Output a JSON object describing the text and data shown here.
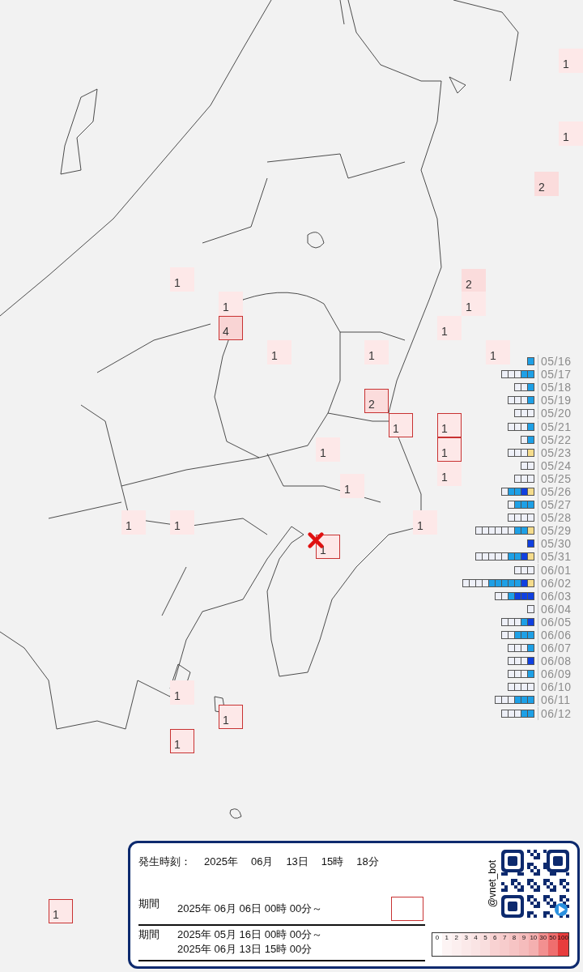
{
  "map": {
    "markers": [
      {
        "label": "1",
        "bordered": false,
        "color": "#fde8e8"
      },
      {
        "label": "1",
        "bordered": false,
        "color": "#fde8e8"
      },
      {
        "label": "2",
        "bordered": false,
        "color": "#fbdcdc"
      },
      {
        "label": "1",
        "bordered": false,
        "color": "#fde8e8"
      },
      {
        "label": "2",
        "bordered": false,
        "color": "#fbdcdc"
      },
      {
        "label": "1",
        "bordered": false,
        "color": "#fde8e8"
      },
      {
        "label": "1",
        "bordered": false,
        "color": "#fde8e8"
      },
      {
        "label": "4",
        "bordered": true,
        "color": "#f9d4d4"
      },
      {
        "label": "1",
        "bordered": false,
        "color": "#fde8e8"
      },
      {
        "label": "1",
        "bordered": false,
        "color": "#fde8e8"
      },
      {
        "label": "1",
        "bordered": false,
        "color": "#fde8e8"
      },
      {
        "label": "1",
        "bordered": false,
        "color": "#fde8e8"
      },
      {
        "label": "2",
        "bordered": true,
        "color": "#fbdcdc"
      },
      {
        "label": "1",
        "bordered": true,
        "color": "#fde8e8"
      },
      {
        "label": "1",
        "bordered": true,
        "color": "#fde8e8"
      },
      {
        "label": "1",
        "bordered": false,
        "color": "#fde8e8"
      },
      {
        "label": "1",
        "bordered": true,
        "color": "#fde8e8"
      },
      {
        "label": "1",
        "bordered": false,
        "color": "#fde8e8"
      },
      {
        "label": "1",
        "bordered": false,
        "color": "#fde8e8"
      },
      {
        "label": "1",
        "bordered": false,
        "color": "#fde8e8"
      },
      {
        "label": "1",
        "bordered": false,
        "color": "#fde8e8"
      },
      {
        "label": "1",
        "bordered": false,
        "color": "#fde8e8"
      },
      {
        "label": "1",
        "bordered": true,
        "color": "#fde8e8"
      },
      {
        "label": "1",
        "bordered": false,
        "color": "#fde8e8"
      },
      {
        "label": "1",
        "bordered": true,
        "color": "#fde8e8"
      },
      {
        "label": "1",
        "bordered": true,
        "color": "#fde8e8"
      },
      {
        "label": "1",
        "bordered": true,
        "color": "#fde8e8"
      }
    ]
  },
  "activity_chart": {
    "rows": [
      {
        "date": "05/16",
        "segments": [
          {
            "kind": "light"
          }
        ]
      },
      {
        "date": "05/17",
        "segments": [
          {
            "kind": "empty"
          },
          {
            "kind": "empty"
          },
          {
            "kind": "empty"
          },
          {
            "kind": "light"
          },
          {
            "kind": "light"
          }
        ]
      },
      {
        "date": "05/18",
        "segments": [
          {
            "kind": "empty"
          },
          {
            "kind": "empty"
          },
          {
            "kind": "light"
          }
        ]
      },
      {
        "date": "05/19",
        "segments": [
          {
            "kind": "empty"
          },
          {
            "kind": "empty"
          },
          {
            "kind": "empty"
          },
          {
            "kind": "light"
          }
        ]
      },
      {
        "date": "05/20",
        "segments": [
          {
            "kind": "empty"
          },
          {
            "kind": "empty"
          },
          {
            "kind": "empty"
          }
        ]
      },
      {
        "date": "05/21",
        "segments": [
          {
            "kind": "empty"
          },
          {
            "kind": "empty"
          },
          {
            "kind": "empty"
          },
          {
            "kind": "light"
          }
        ]
      },
      {
        "date": "05/22",
        "segments": [
          {
            "kind": "empty"
          },
          {
            "kind": "light"
          }
        ]
      },
      {
        "date": "05/23",
        "segments": [
          {
            "kind": "empty"
          },
          {
            "kind": "empty"
          },
          {
            "kind": "empty"
          },
          {
            "kind": "yellow"
          }
        ]
      },
      {
        "date": "05/24",
        "segments": [
          {
            "kind": "empty"
          },
          {
            "kind": "empty"
          }
        ]
      },
      {
        "date": "05/25",
        "segments": [
          {
            "kind": "empty"
          },
          {
            "kind": "empty"
          },
          {
            "kind": "empty"
          }
        ]
      },
      {
        "date": "05/26",
        "segments": [
          {
            "kind": "empty"
          },
          {
            "kind": "light"
          },
          {
            "kind": "light"
          },
          {
            "kind": "dark"
          },
          {
            "kind": "yellow"
          }
        ]
      },
      {
        "date": "05/27",
        "segments": [
          {
            "kind": "empty"
          },
          {
            "kind": "light"
          },
          {
            "kind": "light"
          },
          {
            "kind": "light"
          }
        ]
      },
      {
        "date": "05/28",
        "segments": [
          {
            "kind": "empty"
          },
          {
            "kind": "empty"
          },
          {
            "kind": "empty"
          },
          {
            "kind": "empty"
          }
        ]
      },
      {
        "date": "05/29",
        "segments": [
          {
            "kind": "empty"
          },
          {
            "kind": "empty"
          },
          {
            "kind": "empty"
          },
          {
            "kind": "empty"
          },
          {
            "kind": "empty"
          },
          {
            "kind": "empty"
          },
          {
            "kind": "light"
          },
          {
            "kind": "light"
          },
          {
            "kind": "yellow"
          }
        ]
      },
      {
        "date": "05/30",
        "segments": [
          {
            "kind": "dark"
          }
        ]
      },
      {
        "date": "05/31",
        "segments": [
          {
            "kind": "empty"
          },
          {
            "kind": "empty"
          },
          {
            "kind": "empty"
          },
          {
            "kind": "empty"
          },
          {
            "kind": "empty"
          },
          {
            "kind": "light"
          },
          {
            "kind": "light"
          },
          {
            "kind": "dark"
          },
          {
            "kind": "yellow"
          }
        ]
      },
      {
        "date": "06/01",
        "segments": [
          {
            "kind": "empty"
          },
          {
            "kind": "empty"
          },
          {
            "kind": "empty"
          }
        ]
      },
      {
        "date": "06/02",
        "segments": [
          {
            "kind": "empty"
          },
          {
            "kind": "empty"
          },
          {
            "kind": "empty"
          },
          {
            "kind": "empty"
          },
          {
            "kind": "light"
          },
          {
            "kind": "light"
          },
          {
            "kind": "light"
          },
          {
            "kind": "light"
          },
          {
            "kind": "light"
          },
          {
            "kind": "dark"
          },
          {
            "kind": "yellow"
          }
        ]
      },
      {
        "date": "06/03",
        "segments": [
          {
            "kind": "empty"
          },
          {
            "kind": "empty"
          },
          {
            "kind": "light"
          },
          {
            "kind": "dark"
          },
          {
            "kind": "dark"
          },
          {
            "kind": "dark"
          }
        ]
      },
      {
        "date": "06/04",
        "segments": [
          {
            "kind": "empty"
          }
        ]
      },
      {
        "date": "06/05",
        "segments": [
          {
            "kind": "empty"
          },
          {
            "kind": "empty"
          },
          {
            "kind": "empty"
          },
          {
            "kind": "light"
          },
          {
            "kind": "dark"
          }
        ]
      },
      {
        "date": "06/06",
        "segments": [
          {
            "kind": "empty"
          },
          {
            "kind": "empty"
          },
          {
            "kind": "light"
          },
          {
            "kind": "light"
          },
          {
            "kind": "light"
          }
        ]
      },
      {
        "date": "06/07",
        "segments": [
          {
            "kind": "empty"
          },
          {
            "kind": "empty"
          },
          {
            "kind": "empty"
          },
          {
            "kind": "light"
          }
        ]
      },
      {
        "date": "06/08",
        "segments": [
          {
            "kind": "empty"
          },
          {
            "kind": "empty"
          },
          {
            "kind": "empty"
          },
          {
            "kind": "dark"
          }
        ]
      },
      {
        "date": "06/09",
        "segments": [
          {
            "kind": "empty"
          },
          {
            "kind": "empty"
          },
          {
            "kind": "empty"
          },
          {
            "kind": "light"
          }
        ]
      },
      {
        "date": "06/10",
        "segments": [
          {
            "kind": "empty"
          },
          {
            "kind": "empty"
          },
          {
            "kind": "empty"
          },
          {
            "kind": "empty"
          }
        ]
      },
      {
        "date": "06/11",
        "segments": [
          {
            "kind": "empty"
          },
          {
            "kind": "empty"
          },
          {
            "kind": "empty"
          },
          {
            "kind": "light"
          },
          {
            "kind": "light"
          },
          {
            "kind": "light"
          }
        ]
      },
      {
        "date": "06/12",
        "segments": [
          {
            "kind": "empty"
          },
          {
            "kind": "empty"
          },
          {
            "kind": "empty"
          },
          {
            "kind": "light"
          },
          {
            "kind": "light"
          }
        ]
      }
    ]
  },
  "info_panel": {
    "occurred": {
      "label": "発生時刻：",
      "year": "2025年",
      "month": "06月",
      "day": "13日",
      "hour": "15時",
      "minute": "18分"
    },
    "period_recent": {
      "label": "期間",
      "from": "2025年 06月 06日 00時 00分～"
    },
    "period_total": {
      "label": "期間",
      "from": "2025年 05月 16日 00時 00分～",
      "to": "2025年 06月 13日 15時 00分"
    },
    "account": "@vnet_bot",
    "scale": [
      {
        "label": "0",
        "color": "#ffffff"
      },
      {
        "label": "1",
        "color": "#fdf4f4"
      },
      {
        "label": "2",
        "color": "#fcefef"
      },
      {
        "label": "3",
        "color": "#fbe9e9"
      },
      {
        "label": "4",
        "color": "#fae4e4"
      },
      {
        "label": "5",
        "color": "#f9dede"
      },
      {
        "label": "6",
        "color": "#f8d2d2"
      },
      {
        "label": "7",
        "color": "#f7cccc"
      },
      {
        "label": "8",
        "color": "#f6c4c4"
      },
      {
        "label": "9",
        "color": "#f5bcbc"
      },
      {
        "label": "10",
        "color": "#f4b0b0"
      },
      {
        "label": "30",
        "color": "#f29090"
      },
      {
        "label": "50",
        "color": "#ef6e6e"
      },
      {
        "label": "100",
        "color": "#e83c3c"
      }
    ]
  }
}
